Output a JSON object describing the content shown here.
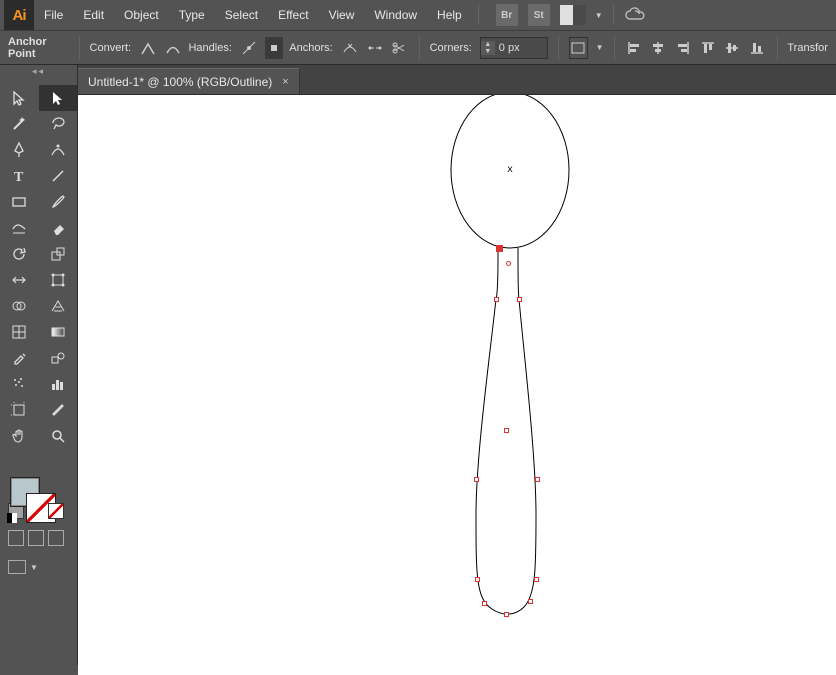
{
  "app": {
    "name": "Ai"
  },
  "menu": {
    "file": "File",
    "edit": "Edit",
    "object": "Object",
    "type": "Type",
    "select": "Select",
    "effect": "Effect",
    "view": "View",
    "window": "Window",
    "help": "Help"
  },
  "menubar_icons": {
    "bridge": "Br",
    "stock": "St"
  },
  "control": {
    "anchor_point": "Anchor Point",
    "convert": "Convert:",
    "handles": "Handles:",
    "anchors": "Anchors:",
    "corners": "Corners:",
    "corner_value": "0 px",
    "transform_truncated": "Transfor"
  },
  "tab": {
    "title": "Untitled-1* @ 100% (RGB/Outline)",
    "close": "×"
  },
  "colors": {
    "accent": "#f7931e",
    "anchor": "#d33",
    "fill_swatch": "#b7c7cc"
  },
  "canvas": {
    "center_mark": "x"
  }
}
